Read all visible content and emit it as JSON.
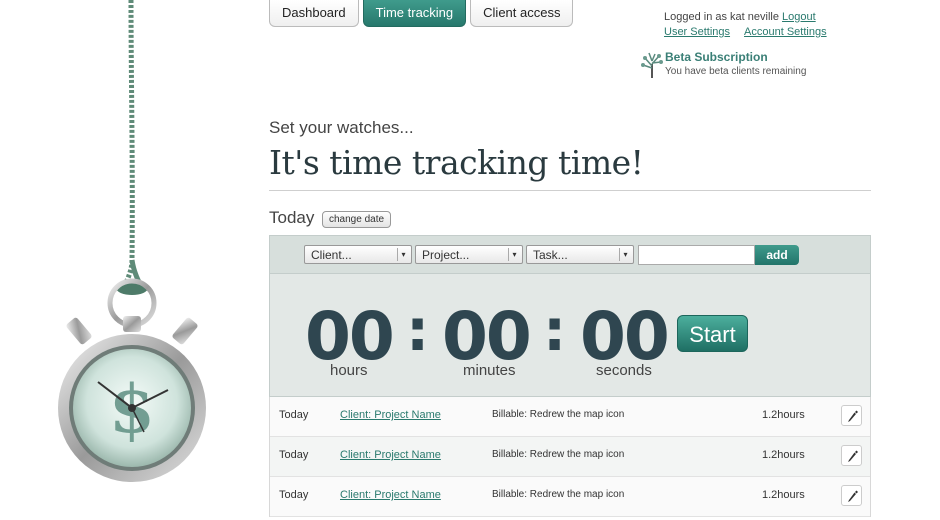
{
  "nav": {
    "tabs": [
      {
        "label": "Dashboard"
      },
      {
        "label": "Time tracking",
        "active": true
      },
      {
        "label": "Client access"
      }
    ]
  },
  "account": {
    "logged_in_prefix": "Logged in as kat neville",
    "logout": "Logout",
    "user_settings": "User Settings",
    "account_settings": "Account Settings"
  },
  "beta": {
    "title": "Beta Subscription",
    "subtitle": "You have beta clients remaining",
    "icon": "tree-icon"
  },
  "header": {
    "subtitle": "Set your watches...",
    "title": "It's time tracking time!"
  },
  "date_bar": {
    "label": "Today",
    "change_button": "change date"
  },
  "tracker": {
    "client_select": "Client...",
    "project_select": "Project...",
    "task_select": "Task...",
    "note_value": "",
    "add_button": "add",
    "hours": "00",
    "minutes": "00",
    "seconds": "00",
    "separator": ":",
    "hours_label": "hours",
    "minutes_label": "minutes",
    "seconds_label": "seconds",
    "start_button": "Start"
  },
  "entries": [
    {
      "day": "Today",
      "project": "Client: Project Name",
      "description": "Billable: Redrew the map icon",
      "hours": "1.2hours"
    },
    {
      "day": "Today",
      "project": "Client: Project Name",
      "description": "Billable: Redrew the map icon",
      "hours": "1.2hours"
    },
    {
      "day": "Today",
      "project": "Client: Project Name",
      "description": "Billable: Redrew the map icon",
      "hours": "1.2hours"
    }
  ],
  "colors": {
    "accent": "#2f8a7c",
    "timer_digits": "#2f4650",
    "panel_bg": "#e3e8e6"
  }
}
